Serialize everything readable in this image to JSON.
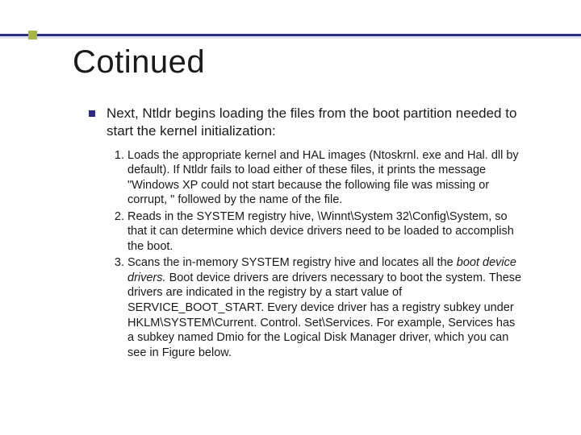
{
  "slide": {
    "title": "Cotinued",
    "lead": "Next, Ntldr begins loading the files from the boot partition needed to start the kernel initialization:",
    "items": [
      {
        "pre": "Loads the appropriate kernel and HAL images (Ntoskrnl. exe and Hal. dll by default). If Ntldr fails to load either of these files, it prints the message \"Windows XP could not start because the following file was missing or corrupt, \" followed by the name of the file."
      },
      {
        "pre": "Reads in the SYSTEM registry hive, \\Winnt\\System 32\\Config\\System, so that it can determine which device drivers need to be loaded to accomplish the boot."
      },
      {
        "pre": "Scans the in-memory SYSTEM registry hive and locates all the ",
        "em": "boot device drivers.",
        "post": " Boot device drivers are drivers necessary to boot the system. These drivers are indicated in the registry by a start value of SERVICE_BOOT_START. Every device driver has a registry subkey under HKLM\\SYSTEM\\Current. Control. Set\\Services. For example, Services has a subkey named Dmio for the Logical Disk Manager driver, which you can see in Figure below."
      }
    ]
  }
}
